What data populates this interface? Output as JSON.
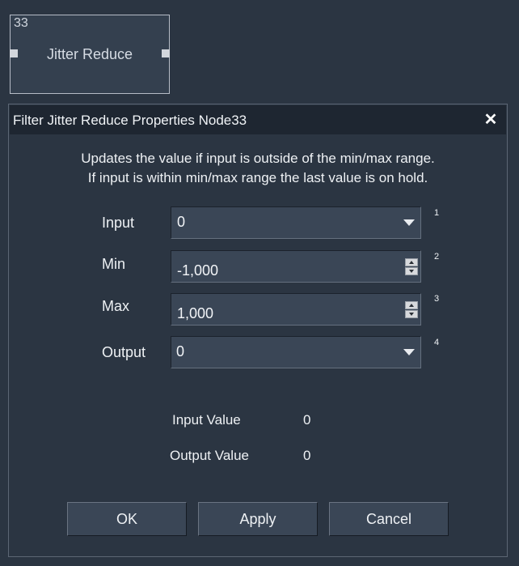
{
  "node": {
    "id": "33",
    "title": "Jitter Reduce"
  },
  "dialog": {
    "title": "Filter Jitter Reduce Properties Node33",
    "close_icon": "close-icon",
    "description": [
      "Updates the value if input is outside of the min/max range.",
      "If input is within min/max range the last value is on hold."
    ],
    "fields": {
      "input": {
        "label": "Input",
        "value": "0",
        "port": "1"
      },
      "min": {
        "label": "Min",
        "value": "-1,000",
        "port": "2"
      },
      "max": {
        "label": "Max",
        "value": "1,000",
        "port": "3"
      },
      "output": {
        "label": "Output",
        "value": "0",
        "port": "4"
      }
    },
    "values": {
      "input_label": "Input Value",
      "input_value": "0",
      "output_label": "Output Value",
      "output_value": "0"
    },
    "buttons": {
      "ok": "OK",
      "apply": "Apply",
      "cancel": "Cancel"
    }
  }
}
